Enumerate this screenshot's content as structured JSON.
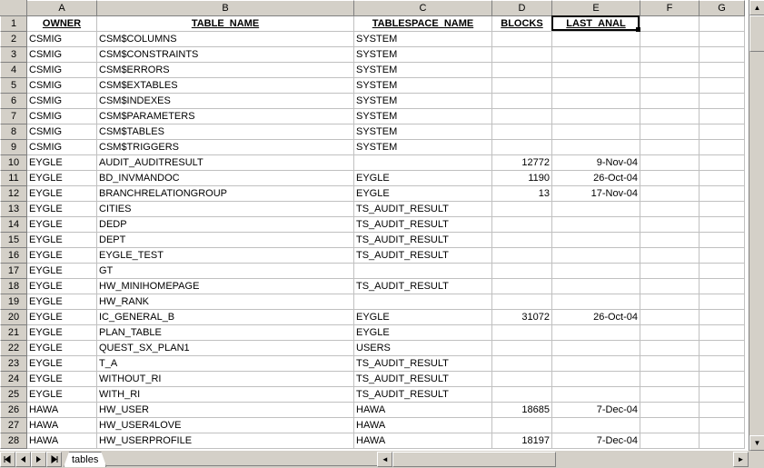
{
  "columns": [
    "A",
    "B",
    "C",
    "D",
    "E",
    "F",
    "G"
  ],
  "column_widths": {
    "A": 77,
    "B": 283,
    "C": 152,
    "D": 66,
    "E": 97,
    "F": 65,
    "G": 50
  },
  "headers": {
    "A": "OWNER",
    "B": "TABLE_NAME",
    "C": "TABLESPACE_NAME",
    "D": "BLOCKS",
    "E": "LAST_ANAL"
  },
  "active_cell": {
    "row": 1,
    "col": "E"
  },
  "sheet_tab": "tables",
  "visible_row_start": 1,
  "visible_row_end": 28,
  "rows": [
    {
      "n": 1,
      "A": "OWNER",
      "B": "TABLE_NAME",
      "C": "TABLESPACE_NAME",
      "D": "BLOCKS",
      "E": "LAST_ANAL",
      "is_header": true
    },
    {
      "n": 2,
      "A": "CSMIG",
      "B": "CSM$COLUMNS",
      "C": "SYSTEM",
      "D": "",
      "E": ""
    },
    {
      "n": 3,
      "A": "CSMIG",
      "B": "CSM$CONSTRAINTS",
      "C": "SYSTEM",
      "D": "",
      "E": ""
    },
    {
      "n": 4,
      "A": "CSMIG",
      "B": "CSM$ERRORS",
      "C": "SYSTEM",
      "D": "",
      "E": ""
    },
    {
      "n": 5,
      "A": "CSMIG",
      "B": "CSM$EXTABLES",
      "C": "SYSTEM",
      "D": "",
      "E": ""
    },
    {
      "n": 6,
      "A": "CSMIG",
      "B": "CSM$INDEXES",
      "C": "SYSTEM",
      "D": "",
      "E": ""
    },
    {
      "n": 7,
      "A": "CSMIG",
      "B": "CSM$PARAMETERS",
      "C": "SYSTEM",
      "D": "",
      "E": ""
    },
    {
      "n": 8,
      "A": "CSMIG",
      "B": "CSM$TABLES",
      "C": "SYSTEM",
      "D": "",
      "E": ""
    },
    {
      "n": 9,
      "A": "CSMIG",
      "B": "CSM$TRIGGERS",
      "C": "SYSTEM",
      "D": "",
      "E": ""
    },
    {
      "n": 10,
      "A": "EYGLE",
      "B": "AUDIT_AUDITRESULT",
      "C": "",
      "D": "12772",
      "E": "9-Nov-04"
    },
    {
      "n": 11,
      "A": "EYGLE",
      "B": "BD_INVMANDOC",
      "C": "EYGLE",
      "D": "1190",
      "E": "26-Oct-04"
    },
    {
      "n": 12,
      "A": "EYGLE",
      "B": "BRANCHRELATIONGROUP",
      "C": "EYGLE",
      "D": "13",
      "E": "17-Nov-04"
    },
    {
      "n": 13,
      "A": "EYGLE",
      "B": "CITIES",
      "C": "TS_AUDIT_RESULT",
      "D": "",
      "E": ""
    },
    {
      "n": 14,
      "A": "EYGLE",
      "B": "DEDP",
      "C": "TS_AUDIT_RESULT",
      "D": "",
      "E": ""
    },
    {
      "n": 15,
      "A": "EYGLE",
      "B": "DEPT",
      "C": "TS_AUDIT_RESULT",
      "D": "",
      "E": ""
    },
    {
      "n": 16,
      "A": "EYGLE",
      "B": "EYGLE_TEST",
      "C": "TS_AUDIT_RESULT",
      "D": "",
      "E": ""
    },
    {
      "n": 17,
      "A": "EYGLE",
      "B": "GT",
      "C": "",
      "D": "",
      "E": ""
    },
    {
      "n": 18,
      "A": "EYGLE",
      "B": "HW_MINIHOMEPAGE",
      "C": "TS_AUDIT_RESULT",
      "D": "",
      "E": ""
    },
    {
      "n": 19,
      "A": "EYGLE",
      "B": "HW_RANK",
      "C": "",
      "D": "",
      "E": ""
    },
    {
      "n": 20,
      "A": "EYGLE",
      "B": "IC_GENERAL_B",
      "C": "EYGLE",
      "D": "31072",
      "E": "26-Oct-04"
    },
    {
      "n": 21,
      "A": "EYGLE",
      "B": "PLAN_TABLE",
      "C": "EYGLE",
      "D": "",
      "E": ""
    },
    {
      "n": 22,
      "A": "EYGLE",
      "B": "QUEST_SX_PLAN1",
      "C": "USERS",
      "D": "",
      "E": ""
    },
    {
      "n": 23,
      "A": "EYGLE",
      "B": "T_A",
      "C": "TS_AUDIT_RESULT",
      "D": "",
      "E": ""
    },
    {
      "n": 24,
      "A": "EYGLE",
      "B": "WITHOUT_RI",
      "C": "TS_AUDIT_RESULT",
      "D": "",
      "E": ""
    },
    {
      "n": 25,
      "A": "EYGLE",
      "B": "WITH_RI",
      "C": "TS_AUDIT_RESULT",
      "D": "",
      "E": ""
    },
    {
      "n": 26,
      "A": "HAWA",
      "B": "HW_USER",
      "C": "HAWA",
      "D": "18685",
      "E": "7-Dec-04"
    },
    {
      "n": 27,
      "A": "HAWA",
      "B": "HW_USER4LOVE",
      "C": "HAWA",
      "D": "",
      "E": ""
    },
    {
      "n": 28,
      "A": "HAWA",
      "B": "HW_USERPROFILE",
      "C": "HAWA",
      "D": "18197",
      "E": "7-Dec-04"
    }
  ]
}
